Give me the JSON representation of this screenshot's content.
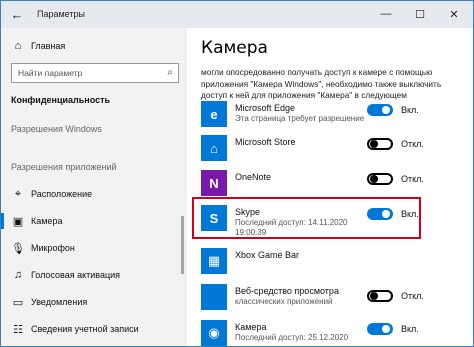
{
  "window": {
    "title": "Параметры",
    "back_icon": "arrow-left-icon",
    "minimize_glyph": "—",
    "maximize_glyph": "☐",
    "close_glyph": "✕"
  },
  "sidebar": {
    "home_label": "Главная",
    "search_placeholder": "Найти параметр",
    "section_heading": "Конфиденциальность",
    "group_windows": "Разрешения Windows",
    "group_apps": "Разрешения приложений",
    "items": [
      {
        "label": "Расположение",
        "icon": "location-icon"
      },
      {
        "label": "Камера",
        "icon": "camera-icon",
        "active": true
      },
      {
        "label": "Микрофон",
        "icon": "microphone-icon"
      },
      {
        "label": "Голосовая активация",
        "icon": "voice-icon"
      },
      {
        "label": "Уведомления",
        "icon": "notifications-icon"
      },
      {
        "label": "Сведения учетной записи",
        "icon": "account-info-icon"
      }
    ]
  },
  "main": {
    "title": "Камера",
    "description": "могли опосредованно получать доступ к камере с помощью приложения \"Камера Windows\", необходимо также выключить доступ к ней для приложения \"Камера\" в следующем",
    "apps": [
      {
        "name": "Microsoft Edge",
        "sub": "Эта страница требует разрешение",
        "toggle": "Вкл.",
        "on": true,
        "tile_color": "#0078d7"
      },
      {
        "name": "Microsoft Store",
        "sub": "",
        "toggle": "Откл.",
        "on": false,
        "tile_color": "#0078d7"
      },
      {
        "name": "OneNote",
        "sub": "",
        "toggle": "Откл.",
        "on": false,
        "tile_color": "#7719aa"
      },
      {
        "name": "Skype",
        "sub": "Последний доступ: 14.11.2020",
        "sub2": "19:00:39",
        "toggle": "Вкл.",
        "on": true,
        "tile_color": "#0078d7"
      },
      {
        "name": "Xbox Game Bar",
        "sub": "",
        "toggle": "",
        "on": false,
        "tile_color": "#0078d7"
      },
      {
        "name": "Веб-средство просмотра",
        "sub": "классических приложений",
        "toggle": "Откл.",
        "on": false,
        "tile_color": "#0078d7"
      },
      {
        "name": "Камера",
        "sub": "Последний доступ: 25.12.2020",
        "toggle": "Вкл.",
        "on": true,
        "tile_color": "#0078d7"
      }
    ]
  },
  "colors": {
    "accent": "#0078d7",
    "highlight": "#d0021b",
    "sidebar_bg": "#f2f2f2"
  }
}
